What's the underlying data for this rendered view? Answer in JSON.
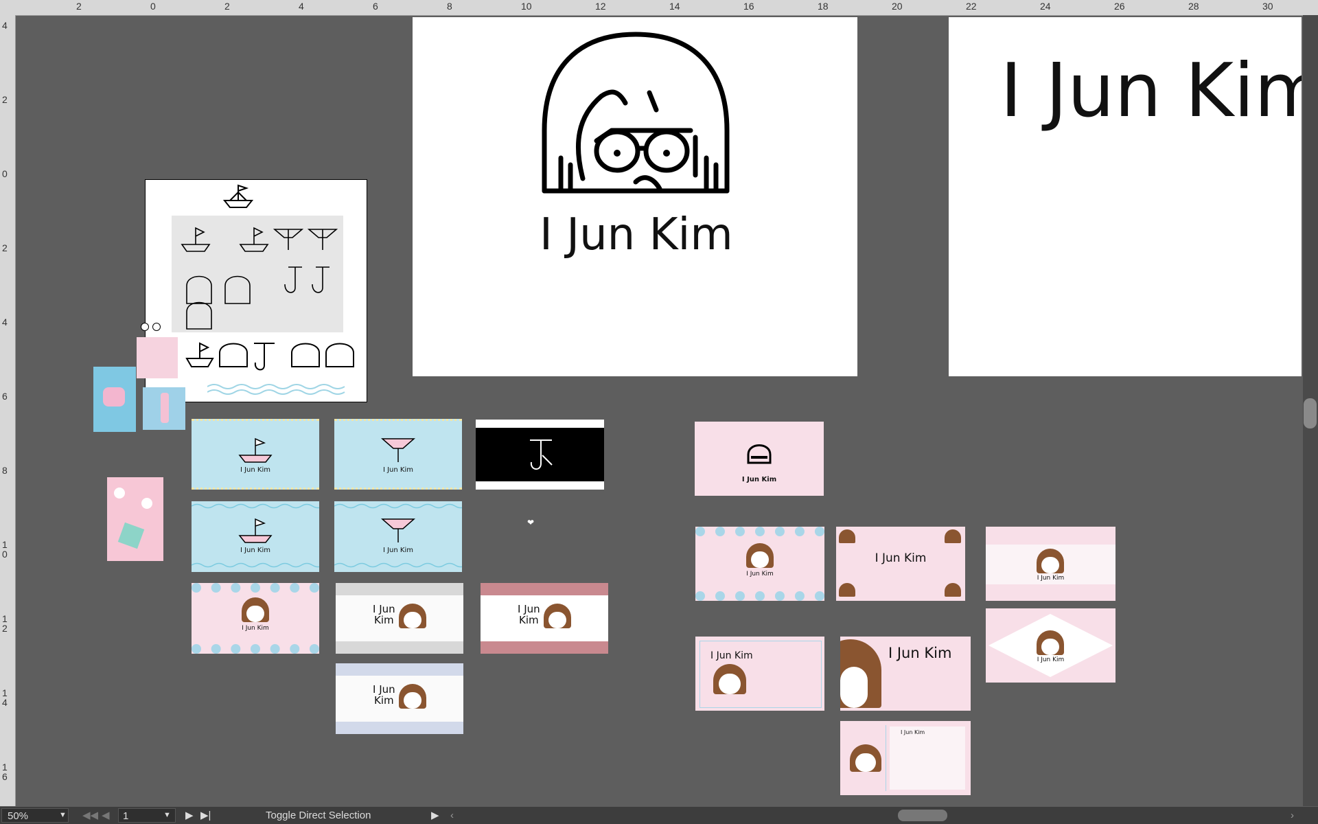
{
  "ruler": {
    "top_labels": [
      "2",
      "0",
      "2",
      "4",
      "6",
      "8",
      "10",
      "12",
      "14",
      "16",
      "18",
      "20",
      "22",
      "24",
      "26",
      "28",
      "30"
    ],
    "left_labels": [
      "4",
      "2",
      "0",
      "2",
      "4",
      "6",
      "8",
      "1 0",
      "1 2",
      "1 4",
      "1 6"
    ]
  },
  "artboards": {
    "logo_text": "I Jun Kim",
    "wordmark_text": "I Jun Kim"
  },
  "cards": {
    "name": "I Jun Kim",
    "name_split_1": "I Jun",
    "name_split_2": "Kim",
    "small_name": "I Jun Kim"
  },
  "status": {
    "zoom": "50%",
    "page": "1",
    "tool_hint": "Toggle Direct Selection"
  },
  "colors": {
    "pasteboard": "#5e5e5e",
    "card_blue": "#bfe4ef",
    "card_pink": "#f8dfe8",
    "hair_brown": "#8a5530"
  }
}
